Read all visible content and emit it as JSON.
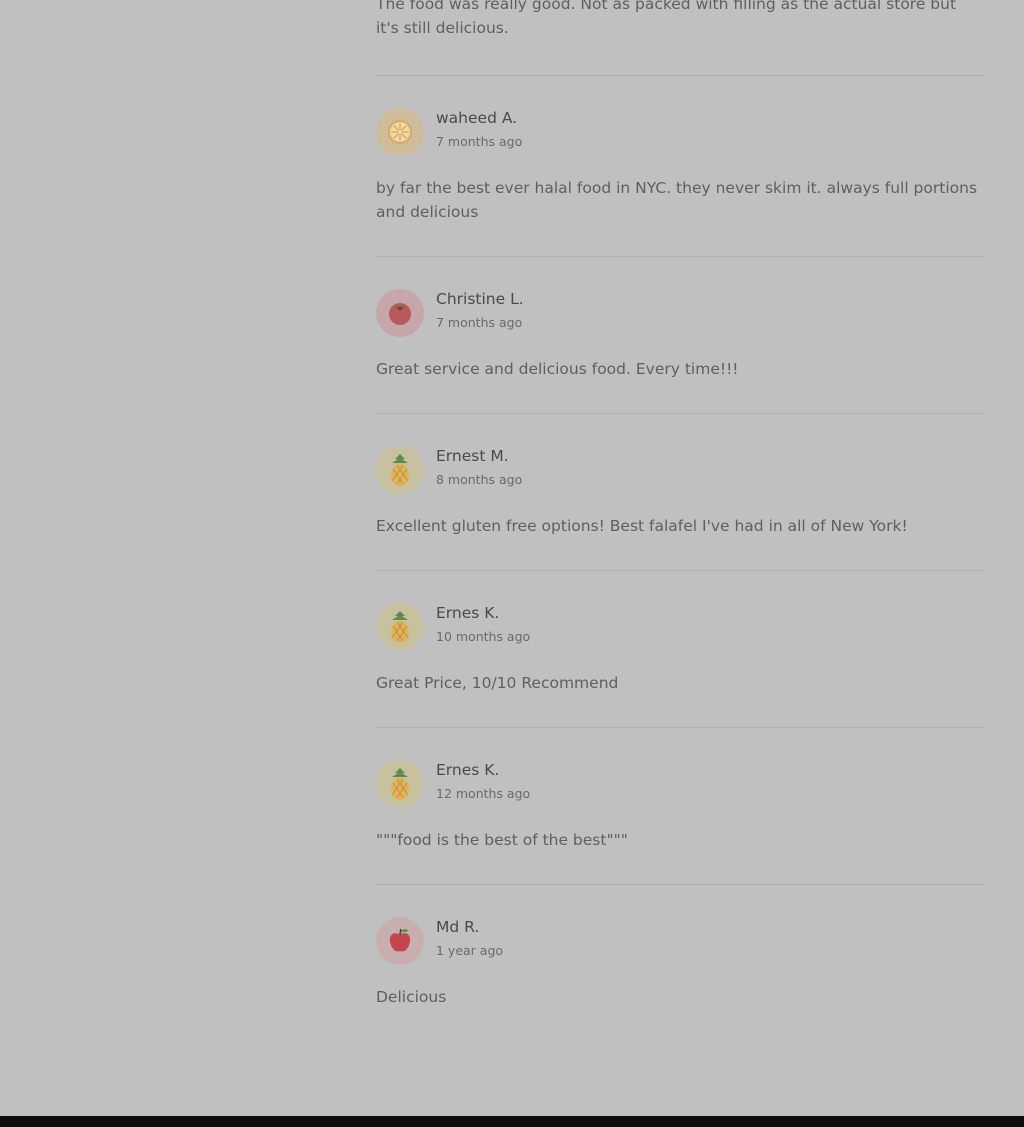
{
  "partial_review": {
    "text": "The food was really good. Not as packed with filling as the actual store but it's still delicious."
  },
  "reviews": [
    {
      "name": "waheed A.",
      "time": "7 months ago",
      "text": "by far the best ever halal food in NYC. they never skim it. always full portions and delicious",
      "avatar_icon": "orange-slice-icon"
    },
    {
      "name": "Christine L.",
      "time": "7 months ago",
      "text": "Great service and delicious food. Every time!!!",
      "avatar_icon": "tomato-icon"
    },
    {
      "name": "Ernest M.",
      "time": "8 months ago",
      "text": "Excellent gluten free options! Best falafel I've had in all of New York!",
      "avatar_icon": "pineapple-icon"
    },
    {
      "name": "Ernes K.",
      "time": "10 months ago",
      "text": "Great Price, 10/10 Recommend",
      "avatar_icon": "pineapple-icon"
    },
    {
      "name": "Ernes K.",
      "time": "12 months ago",
      "text": "\"\"\"food is the best of the best\"\"\"",
      "avatar_icon": "pineapple-icon"
    },
    {
      "name": "Md R.",
      "time": "1 year ago",
      "text": "Delicious",
      "avatar_icon": "apple-icon"
    }
  ],
  "colors": {
    "background": "#c0c0c0",
    "orange_avatar_bg": "#cdbd9a",
    "tomato_avatar_bg": "#c5a6a9",
    "pineapple_avatar_bg": "#c7c19f",
    "apple_avatar_bg": "#c9aeb0",
    "footer": "#0d0d0d"
  }
}
